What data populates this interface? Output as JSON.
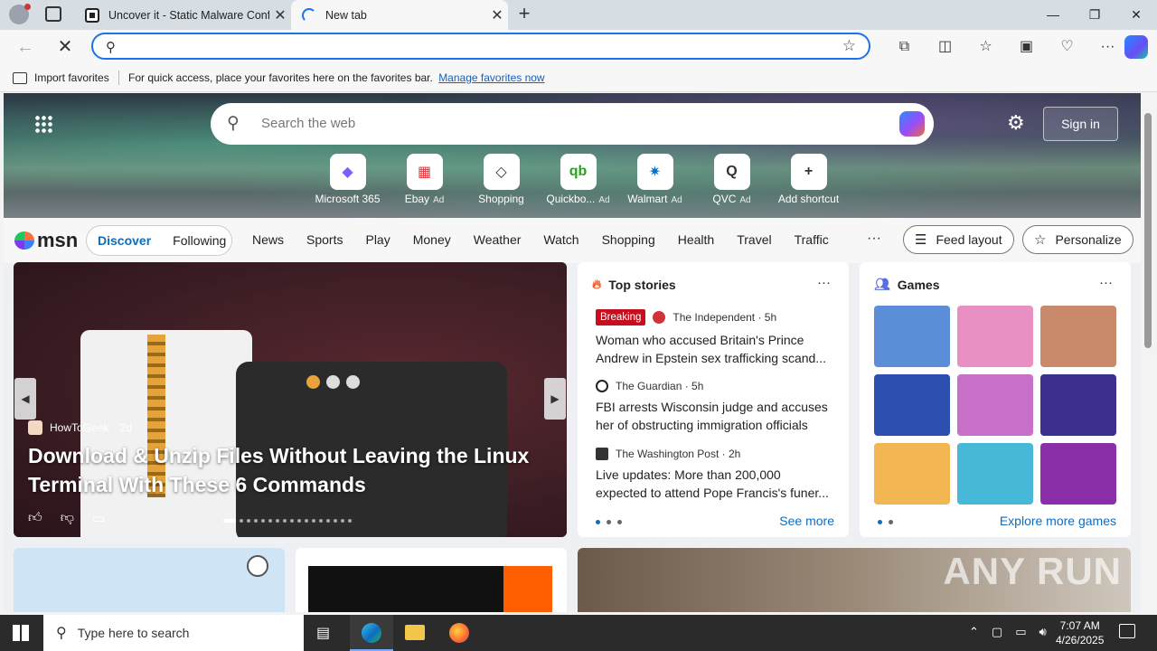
{
  "tabs": [
    {
      "title": "Uncover it - Static Malware Confi"
    },
    {
      "title": "New tab"
    }
  ],
  "toolbar": {
    "address_value": "",
    "address_placeholder": ""
  },
  "favorites_bar": {
    "import_label": "Import favorites",
    "tip_text": "For quick access, place your favorites here on the favorites bar.",
    "manage_link": "Manage favorites now"
  },
  "hero": {
    "search_placeholder": "Search the web",
    "signin_label": "Sign in",
    "shortcuts": [
      {
        "label": "Microsoft 365",
        "ad": "",
        "glyph": "◆",
        "color": "#7b61ff"
      },
      {
        "label": "Ebay",
        "ad": "Ad",
        "glyph": "▦",
        "color": "#e53238"
      },
      {
        "label": "Shopping",
        "ad": "",
        "glyph": "◇",
        "color": "#333333"
      },
      {
        "label": "Quickbo...",
        "ad": "Ad",
        "glyph": "qb",
        "color": "#2ca01c"
      },
      {
        "label": "Walmart",
        "ad": "Ad",
        "glyph": "✷",
        "color": "#0071ce"
      },
      {
        "label": "QVC",
        "ad": "Ad",
        "glyph": "Q",
        "color": "#333333"
      },
      {
        "label": "Add shortcut",
        "ad": "",
        "glyph": "+",
        "color": "#333333"
      }
    ]
  },
  "msn": {
    "logo": "msn",
    "discover": "Discover",
    "following": "Following",
    "links": [
      "News",
      "Sports",
      "Play",
      "Money",
      "Weather",
      "Watch",
      "Shopping",
      "Health",
      "Travel",
      "Traffic"
    ],
    "more": "···",
    "feed_layout": "Feed layout",
    "personalize": "Personalize"
  },
  "feature": {
    "source": "HowToGeek",
    "age": "· 2d",
    "headline": "Download & Unzip Files Without Leaving the Linux Terminal With These 6 Commands"
  },
  "top_stories": {
    "heading": "Top stories",
    "more": "···",
    "items": [
      {
        "badge": "Breaking",
        "source": "The Independent · 5h",
        "title": "Woman who accused Britain's Prince Andrew in Epstein sex trafficking scand..."
      },
      {
        "badge": "",
        "source": "The Guardian · 5h",
        "title": "FBI arrests Wisconsin judge and accuses her of obstructing immigration officials"
      },
      {
        "badge": "",
        "source": "The Washington Post · 2h",
        "title": "Live updates: More than 200,000 expected to attend Pope Francis's funer..."
      }
    ],
    "see_more": "See more"
  },
  "games": {
    "heading": "Games",
    "more": "···",
    "explore": "Explore more games",
    "tiles": [
      {
        "name": "game-tile-1",
        "color": "#5b8ed6"
      },
      {
        "name": "game-tile-2",
        "color": "#e88fc4"
      },
      {
        "name": "game-tile-3",
        "color": "#c98a6b"
      },
      {
        "name": "game-tile-4",
        "color": "#2c4fb0"
      },
      {
        "name": "game-tile-5",
        "color": "#c86fc9"
      },
      {
        "name": "game-tile-6",
        "color": "#3b2f8f"
      },
      {
        "name": "game-tile-7",
        "color": "#f2b652"
      },
      {
        "name": "game-tile-8",
        "color": "#48b8d8"
      },
      {
        "name": "game-tile-9",
        "color": "#8a2fa8"
      }
    ]
  },
  "watermark": "ANY RUN"
}
